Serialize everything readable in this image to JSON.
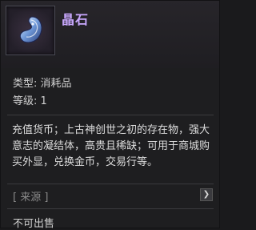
{
  "item": {
    "name": "晶石",
    "name_color": "#c9a8ff",
    "icon": "crystal-gem-icon",
    "type_text": "类型: 消耗品",
    "level_text": "等级: 1",
    "description": "充值货币；上古神创世之初的存在物，强大意志的凝结体，高贵且稀缺；可用于商城购买外显，兑换金币，交易行等。"
  },
  "source": {
    "label": "[ 来源 ]",
    "arrow": "❯"
  },
  "footer": {
    "trade_status": "不可出售"
  }
}
